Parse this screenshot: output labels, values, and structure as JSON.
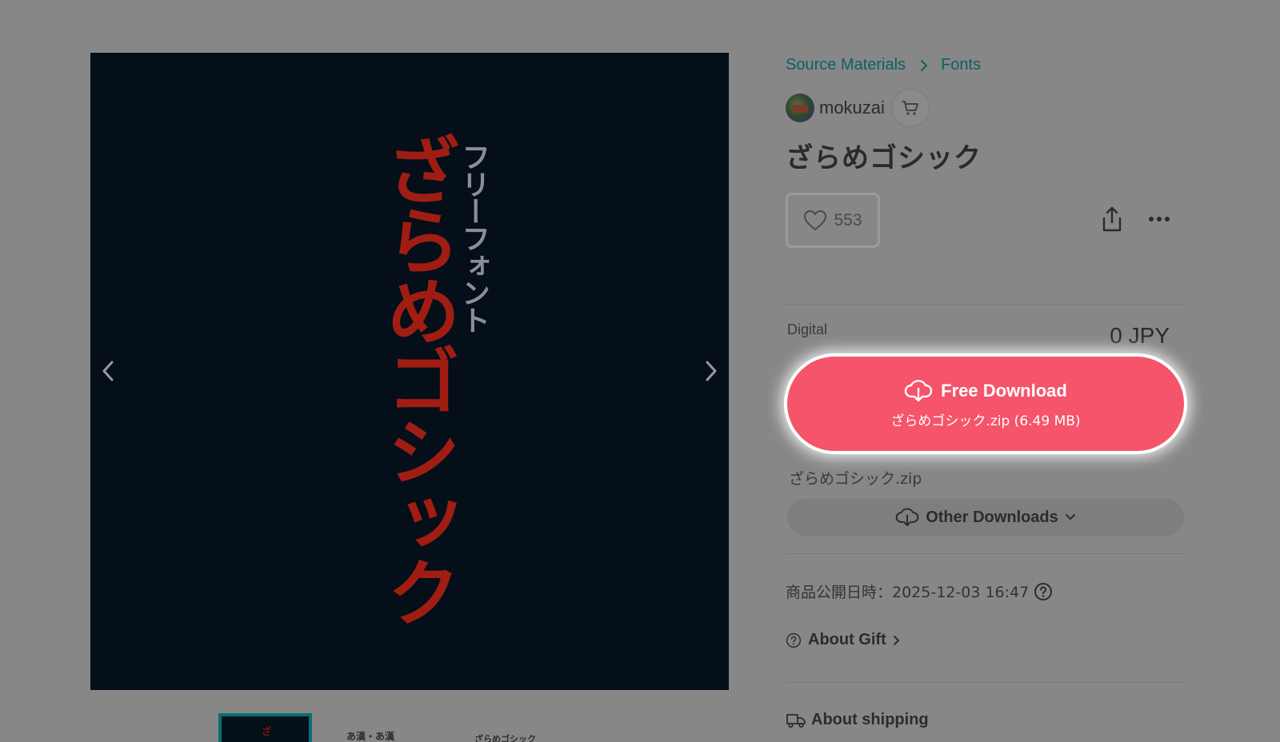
{
  "gallery": {
    "title_vertical": "ざらめゴシック",
    "subtitle_vertical": "フリーフォント",
    "thumbnails": [
      {
        "label": "ざ"
      },
      {
        "label": "あ漢・あ漢"
      },
      {
        "label": "ざらめゴシック"
      }
    ]
  },
  "breadcrumb": {
    "items": [
      "Source Materials",
      "Fonts"
    ]
  },
  "shop": {
    "name": "mokuzai"
  },
  "product": {
    "title": "ざらめゴシック",
    "likes": "553",
    "format_label": "Digital",
    "price": "0 JPY",
    "download_label": "Free Download",
    "download_file": "ざらめゴシック.zip (6.49 MB)",
    "zip_name": "ざらめゴシック.zip",
    "other_downloads_label": "Other Downloads",
    "published": "商品公開日時：2025-12-03 16:47",
    "about_gift_label": "About Gift",
    "about_shipping_label": "About shipping"
  },
  "colors": {
    "accent": "#f5546a",
    "link": "#0e5f63",
    "overlay": "#878787"
  },
  "icons": [
    "chevron-left-icon",
    "chevron-right-icon",
    "breadcrumb-chevron-icon",
    "cart-icon",
    "heart-icon",
    "share-icon",
    "more-icon",
    "cloud-download-icon",
    "chevron-down-icon",
    "help-icon",
    "gift-help-icon",
    "truck-icon"
  ]
}
